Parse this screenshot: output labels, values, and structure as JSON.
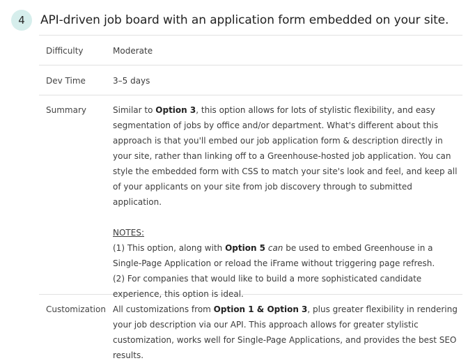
{
  "header": {
    "number": "4",
    "title": "API-driven job board with an application form embedded on your site."
  },
  "rows": {
    "difficulty": {
      "label": "Difficulty",
      "value": "Moderate"
    },
    "dev_time": {
      "label": "Dev Time",
      "value": "3–5 days"
    },
    "summary": {
      "label": "Summary",
      "intro_pre": "Similar to ",
      "intro_bold": "Option 3",
      "intro_post": ", this option allows for lots of stylistic flexibility, and easy segmentation of jobs by office and/or department. What's different about this approach is that you'll embed our job application form & description directly in your site, rather than linking off to a Greenhouse-hosted job application. You can style the embedded form with CSS to match your site's look and feel, and keep all of your applicants on your site from job discovery through to submitted application.",
      "notes_heading": "NOTES:",
      "note1_pre": "(1) This option, along with ",
      "note1_bold": "Option 5",
      "note1_space": " ",
      "note1_italic": "can",
      "note1_post": " be used to embed Greenhouse in a Single-Page Application or reload the iFrame without triggering page refresh.",
      "note2": "(2) For companies that would like to build a more sophisticated candidate experience, this option is ideal."
    },
    "customization": {
      "label": "Customization",
      "text_pre": "All customizations from ",
      "text_bold": "Option 1 & Option 3",
      "text_post": ", plus greater flexibility in rendering your job description via our API. This approach allows for greater stylistic customization, works well for Single-Page Applications, and provides the best SEO results."
    }
  }
}
